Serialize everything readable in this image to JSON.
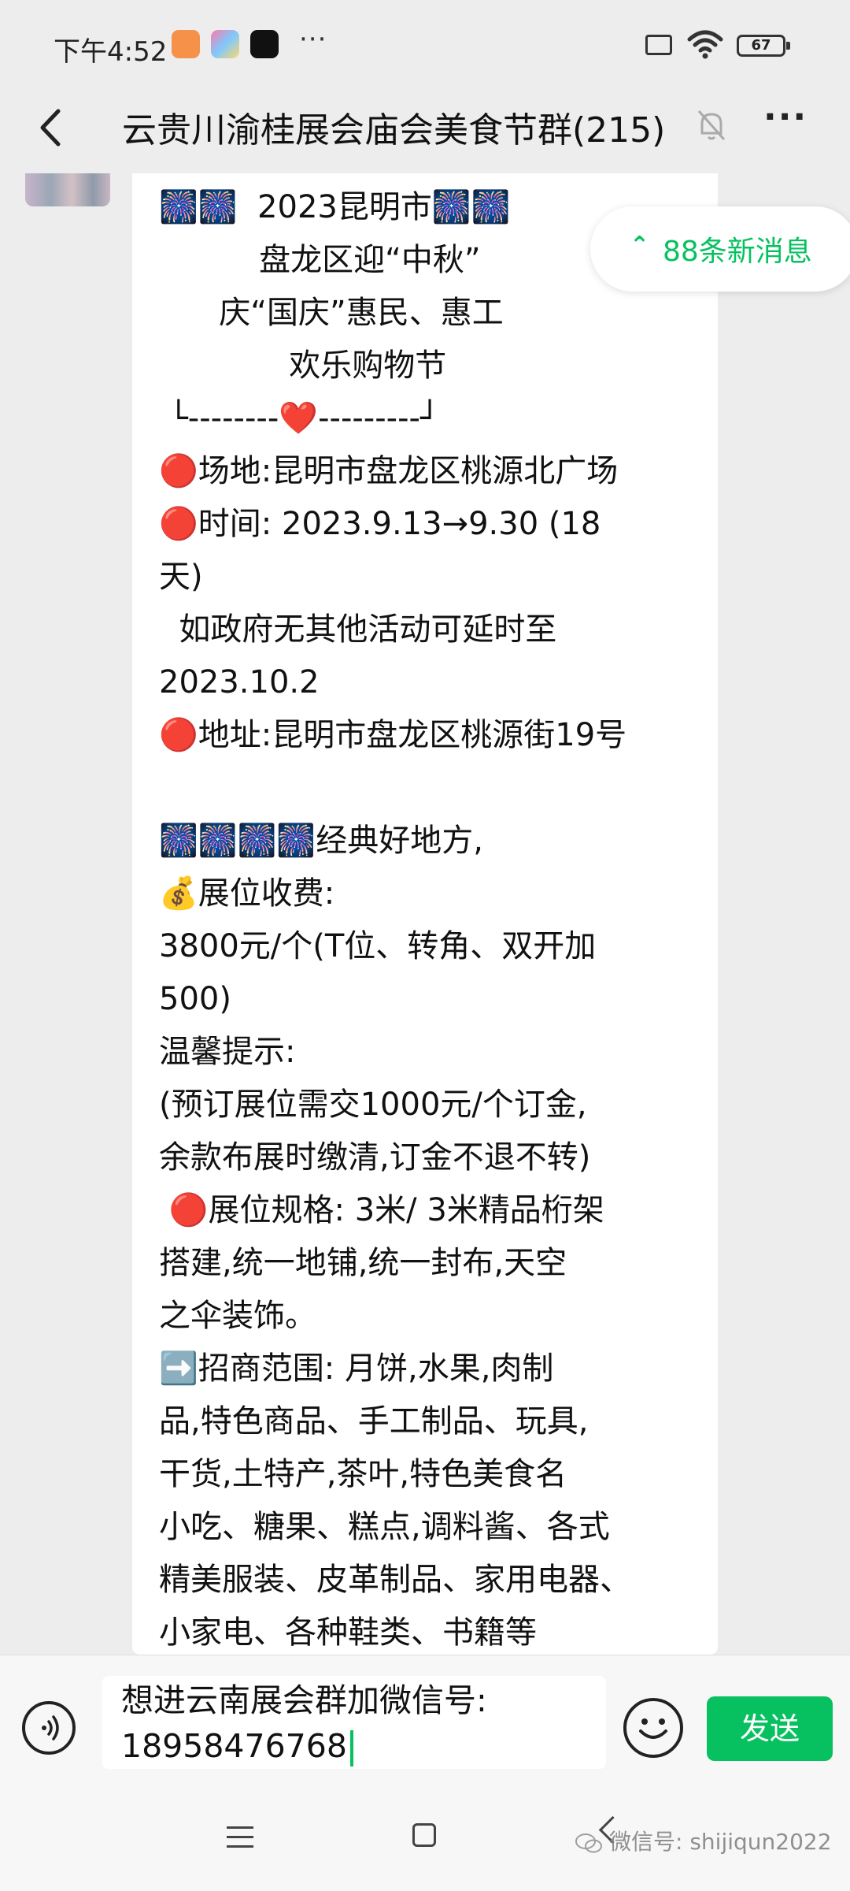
{
  "status_bar": {
    "time": "下午4:52",
    "more": "···",
    "battery": "67"
  },
  "header": {
    "title": "云贵川渝桂展会庙会美食节群(215)",
    "more": "···"
  },
  "new_messages": {
    "label": "88条新消息"
  },
  "message": {
    "lines": [
      "🎆🎆  2023昆明市🎆🎆",
      "          盘龙区迎“中秋”",
      "      庆“国庆”惠民、惠工",
      "             欢乐购物节",
      " └--------❤️---------┘",
      "🔴场地:昆明市盘龙区桃源北广场",
      "🔴时间: 2023.9.13→9.30 (18",
      "天)",
      "  如政府无其他活动可延时至",
      "2023.10.2",
      "🔴地址:昆明市盘龙区桃源街19号",
      "",
      "🎆🎆🎆🎆经典好地方,",
      "💰展位收费:",
      "3800元/个(T位、转角、双开加",
      "500)",
      "温馨提示:",
      "(预订展位需交1000元/个订金,",
      "余款布展时缴清,订金不退不转)",
      " 🔴展位规格: 3米/ 3米精品桁架",
      "搭建,统一地铺,统一封布,天空",
      "之伞装饰。",
      "➡️招商范围: 月饼,水果,肉制",
      "品,特色商品、手工制品、玩具,",
      "干货,土特产,茶叶,特色美食名",
      "小吃、糖果、糕点,调料酱、各式",
      "精美服装、皮革制品、家用电器、",
      "小家电、各种鞋类、书籍等"
    ]
  },
  "input": {
    "line1": "想进云南展会群加微信号:",
    "line2": "18958476768"
  },
  "send_button": "发送",
  "watermark": "微信号: shijiqun2022",
  "colors": {
    "accent": "#07c160",
    "background": "#ededed",
    "bubble": "#ffffff"
  }
}
